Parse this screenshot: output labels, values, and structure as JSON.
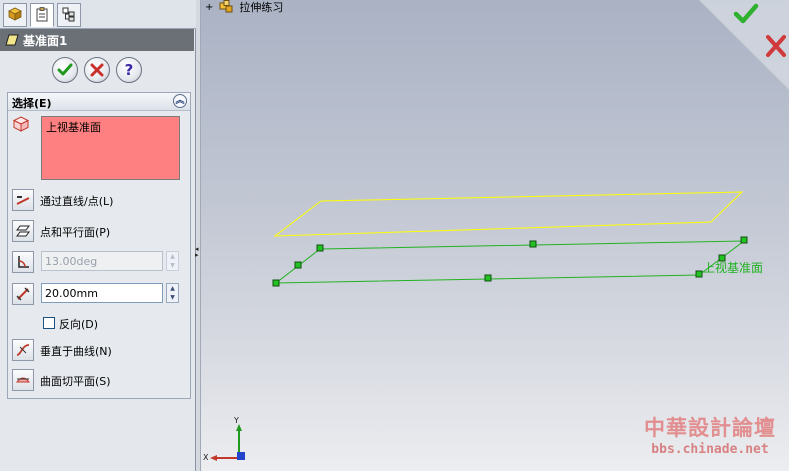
{
  "panel": {
    "tabs": [
      {
        "icon": "feature-tree-icon"
      },
      {
        "icon": "property-manager-icon",
        "active": true
      },
      {
        "icon": "configuration-manager-icon"
      }
    ],
    "title": "基准面1",
    "title_icon": "plane-icon",
    "buttons": {
      "ok_icon": "check-icon",
      "cancel_icon": "x-icon",
      "help_icon": "question-icon"
    },
    "section": {
      "header": "选择(E)",
      "reference": "上视基准面",
      "options": {
        "through_line_point": "通过直线/点(L)",
        "point_parallel": "点和平行面(P)",
        "angle_value": "13.00deg",
        "distance_value": "20.00mm",
        "reverse": "反向(D)",
        "normal_to_curve": "垂直于曲线(N)",
        "tangent_to_surface": "曲面切平面(S)"
      }
    }
  },
  "viewport": {
    "tree_root": "拉伸练习",
    "plane_label": "上视基准面",
    "triad": {
      "y": "Y",
      "x": "X"
    },
    "watermark": {
      "line1": "中華設計論壇",
      "line2": "bbs.chinade.net"
    },
    "colors": {
      "preview_plane": "#ffff00",
      "reference_plane": "#22b222",
      "accept": "#2fb12f",
      "cancel": "#d03a3a"
    }
  }
}
